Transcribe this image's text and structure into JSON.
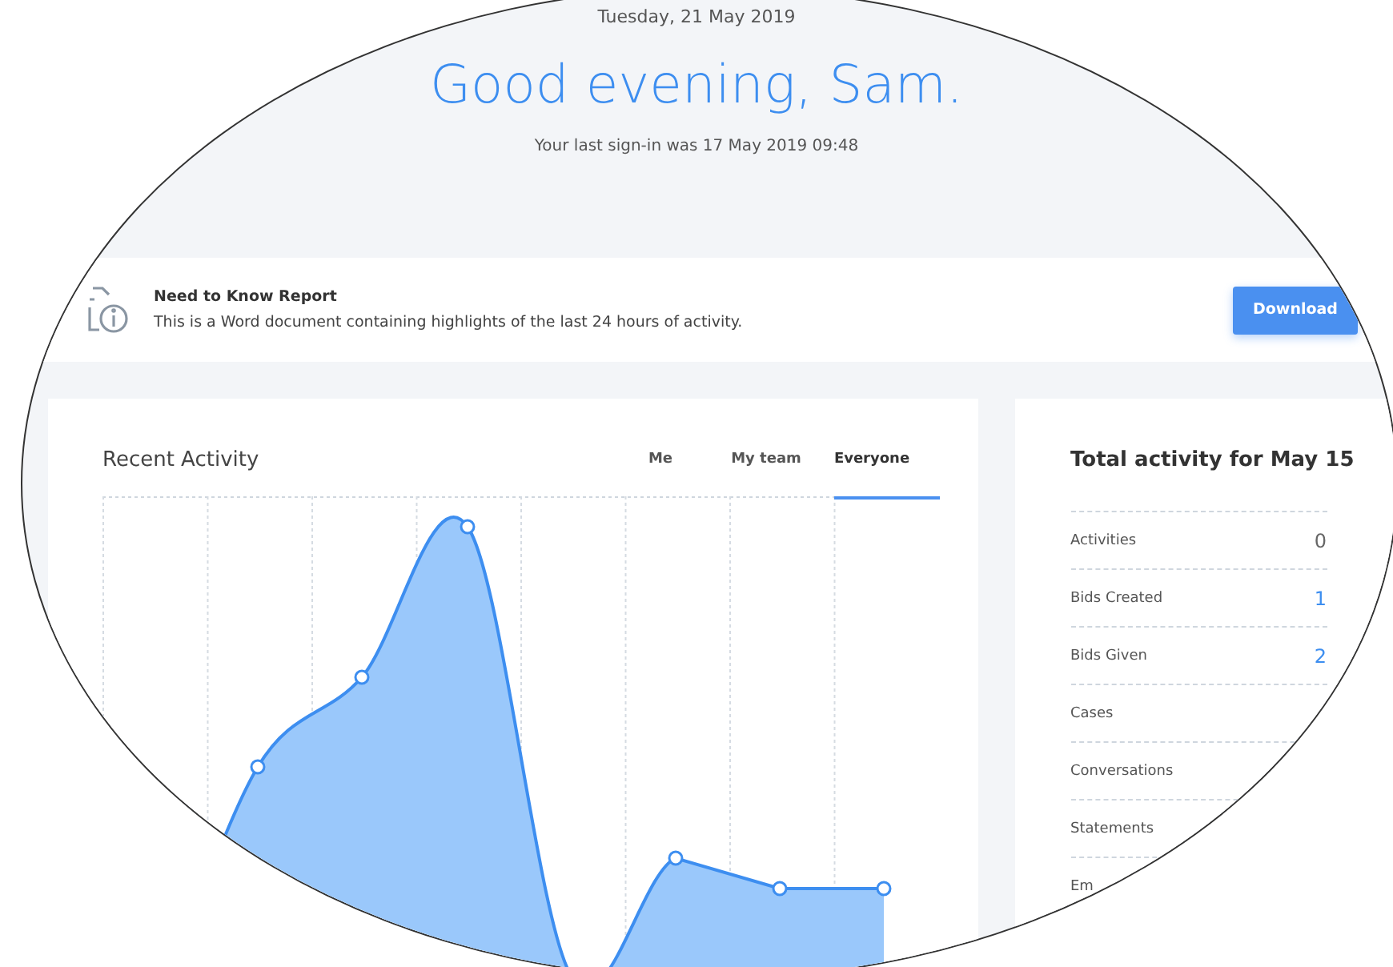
{
  "header": {
    "date": "Tuesday, 21 May 2019",
    "greeting": "Good evening, Sam.",
    "last_signin": "Your last sign-in was 17 May 2019 09:48"
  },
  "report": {
    "title": "Need to Know Report",
    "description": "This is a Word document containing highlights of the last 24 hours of activity.",
    "button": "Download"
  },
  "recent_activity": {
    "title": "Recent Activity",
    "tabs": [
      {
        "label": "Me",
        "selected": false
      },
      {
        "label": "My team",
        "selected": false
      },
      {
        "label": "Everyone",
        "selected": true
      }
    ]
  },
  "total_activity": {
    "title": "Total activity for May 15",
    "rows": [
      {
        "label": "Activities",
        "value": "0",
        "highlighted": false
      },
      {
        "label": "Bids Created",
        "value": "1",
        "highlighted": true
      },
      {
        "label": "Bids Given",
        "value": "2",
        "highlighted": true
      },
      {
        "label": "Cases"
      },
      {
        "label": "Conversations"
      },
      {
        "label": "Statements"
      },
      {
        "label": "Em"
      }
    ]
  }
}
